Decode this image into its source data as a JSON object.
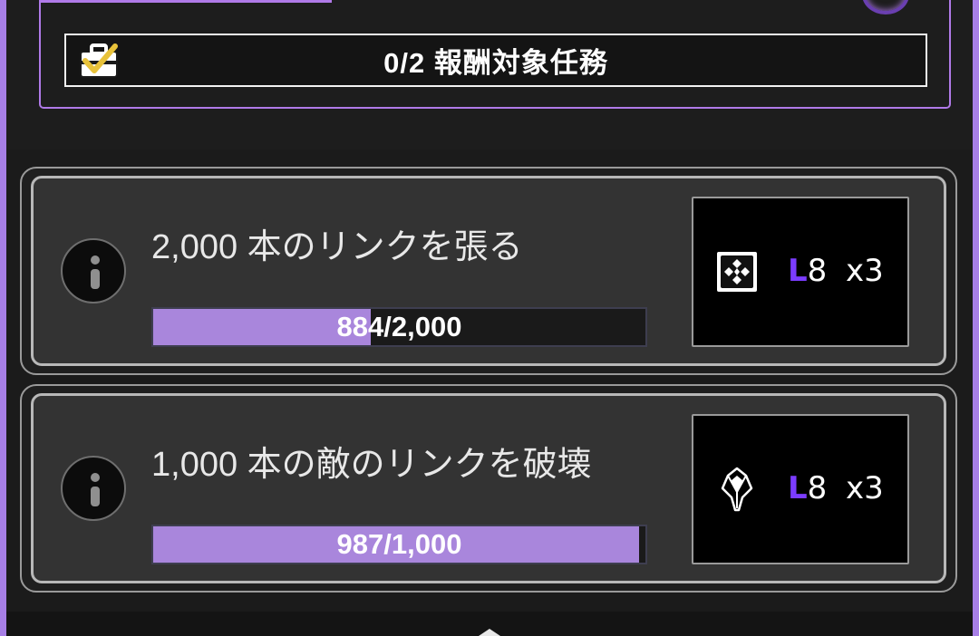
{
  "header": {
    "task_summary": "0/2 報酬対象任務",
    "icon": "briefcase-check-icon"
  },
  "missions": [
    {
      "title": "2,000 本のリンクを張る",
      "progress_text": "884/2,000",
      "progress_current": 884,
      "progress_total": 2000,
      "reward": {
        "icon": "power-cube-icon",
        "level_prefix": "L",
        "level_number": "8",
        "quantity": "x3"
      }
    },
    {
      "title": "1,000 本の敵のリンクを破壊",
      "progress_text": "987/1,000",
      "progress_current": 987,
      "progress_total": 1000,
      "reward": {
        "icon": "ultra-strike-icon",
        "level_prefix": "L",
        "level_number": "8",
        "quantity": "x3"
      }
    }
  ],
  "colors": {
    "accent": "#a986dc",
    "frame": "#b07ae8",
    "level_letter": "#7b3cff"
  }
}
